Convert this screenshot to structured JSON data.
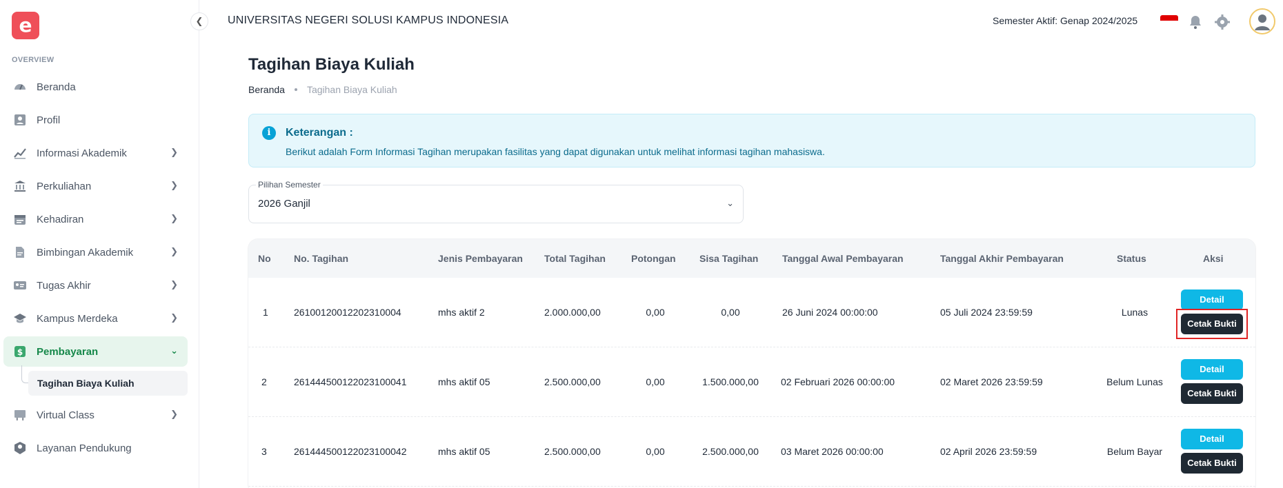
{
  "brand": {
    "logo_letter": "e"
  },
  "sidebar": {
    "section_label": "OVERVIEW",
    "items": [
      {
        "label": "Beranda",
        "icon": "gauge-icon",
        "has_chevron": false
      },
      {
        "label": "Profil",
        "icon": "user-card-icon",
        "has_chevron": false
      },
      {
        "label": "Informasi Akademik",
        "icon": "chart-up-icon",
        "has_chevron": true
      },
      {
        "label": "Perkuliahan",
        "icon": "building-icon",
        "has_chevron": true
      },
      {
        "label": "Kehadiran",
        "icon": "calendar-icon",
        "has_chevron": true
      },
      {
        "label": "Bimbingan Akademik",
        "icon": "document-icon",
        "has_chevron": true
      },
      {
        "label": "Tugas Akhir",
        "icon": "id-card-icon",
        "has_chevron": true
      },
      {
        "label": "Kampus Merdeka",
        "icon": "graduation-cap-icon",
        "has_chevron": true
      },
      {
        "label": "Pembayaran",
        "icon": "money-icon",
        "has_chevron": true,
        "active": true
      },
      {
        "label": "Virtual Class",
        "icon": "board-icon",
        "has_chevron": true
      },
      {
        "label": "Layanan Pendukung",
        "icon": "support-box-icon",
        "has_chevron": false
      }
    ],
    "sub_item": "Tagihan Biaya Kuliah"
  },
  "header": {
    "university": "UNIVERSITAS NEGERI SOLUSI KAMPUS INDONESIA",
    "semester_active": "Semester Aktif: Genap 2024/2025"
  },
  "page": {
    "title": "Tagihan Biaya Kuliah",
    "breadcrumb": {
      "home": "Beranda",
      "current": "Tagihan Biaya Kuliah"
    }
  },
  "alert": {
    "title": "Keterangan :",
    "text": "Berikut adalah Form Informasi Tagihan merupakan fasilitas yang dapat digunakan untuk melihat informasi tagihan mahasiswa."
  },
  "semester_select": {
    "label": "Pilihan Semester",
    "value": "2026 Ganjil"
  },
  "table": {
    "headers": {
      "no": "No",
      "no_tagihan": "No. Tagihan",
      "jenis": "Jenis Pembayaran",
      "total": "Total Tagihan",
      "potongan": "Potongan",
      "sisa": "Sisa Tagihan",
      "awal": "Tanggal Awal Pembayaran",
      "akhir": "Tanggal Akhir Pembayaran",
      "status": "Status",
      "aksi": "Aksi"
    },
    "rows": [
      {
        "no": "1",
        "no_tagihan": "26100120012202310004",
        "jenis": "mhs aktif 2",
        "total": "2.000.000,00",
        "potongan": "0,00",
        "sisa": "0,00",
        "awal": "26 Juni 2024 00:00:00",
        "akhir": "05 Juli 2024 23:59:59",
        "status": "Lunas"
      },
      {
        "no": "2",
        "no_tagihan": "261444500122023100041",
        "jenis": "mhs aktif 05",
        "total": "2.500.000,00",
        "potongan": "0,00",
        "sisa": "1.500.000,00",
        "awal": "02 Februari 2026 00:00:00",
        "akhir": "02 Maret 2026 23:59:59",
        "status": "Belum Lunas"
      },
      {
        "no": "3",
        "no_tagihan": "261444500122023100042",
        "jenis": "mhs aktif 05",
        "total": "2.500.000,00",
        "potongan": "0,00",
        "sisa": "2.500.000,00",
        "awal": "03 Maret 2026 00:00:00",
        "akhir": "02 April 2026 23:59:59",
        "status": "Belum Bayar"
      }
    ],
    "detail_label": "Detail",
    "cetak_label": "Cetak Bukti"
  },
  "colors": {
    "accent_green": "#16884a",
    "detail_button": "#0fb8e6",
    "cetak_button": "#1f2933",
    "logo": "#ef4f59",
    "alert_bg": "#e6f7fc"
  }
}
